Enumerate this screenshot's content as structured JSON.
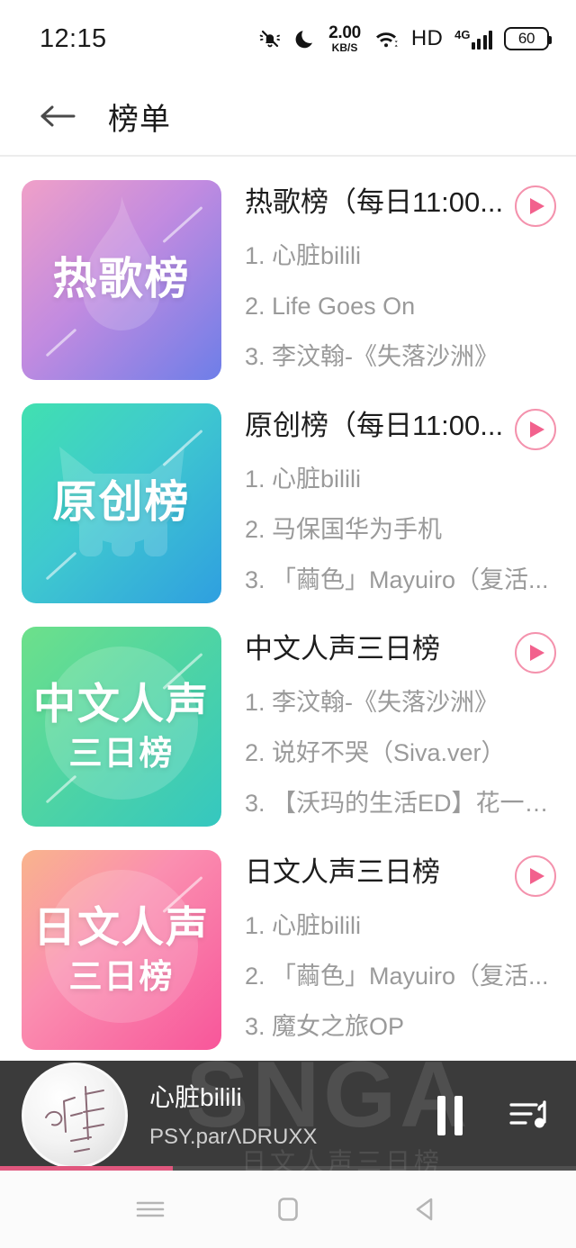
{
  "statusbar": {
    "time": "12:15",
    "network_speed": {
      "value": "2.00",
      "unit": "KB/S"
    },
    "hd_label": "HD",
    "network_type": "4G",
    "battery_level": "60",
    "icons": [
      "bell-mute-icon",
      "moon-dnd-icon",
      "wifi-icon",
      "signal-bars-icon",
      "battery-icon"
    ]
  },
  "appbar": {
    "back_icon": "back-arrow-icon",
    "title": "榜单"
  },
  "rankings": [
    {
      "title": "热歌榜（每日11:00...",
      "thumb": {
        "line1": "热歌榜",
        "line2": "",
        "gradient_from": "#f0a0c8",
        "gradient_to": "#6e7ee8",
        "watermark": "flame-icon"
      },
      "songs": [
        "1. 心脏bilili",
        "2. Life Goes On",
        "3. 李汶翰-《失落沙洲》"
      ],
      "play_label": "play-icon"
    },
    {
      "title": "原创榜（每日11:00...",
      "thumb": {
        "line1": "原创榜",
        "line2": "",
        "gradient_from": "#41e0b0",
        "gradient_to": "#2f9fe0",
        "watermark": "cat-logo-icon"
      },
      "songs": [
        "1. 心脏bilili",
        "2. 马保国华为手机",
        "3. 「繭色」Mayuiro（复活..."
      ],
      "play_label": "play-icon"
    },
    {
      "title": "中文人声三日榜",
      "thumb": {
        "line1": "中文人声",
        "line2": "三日榜",
        "gradient_from": "#6de08a",
        "gradient_to": "#35c7c0",
        "watermark": "disc-icon"
      },
      "songs": [
        "1. 李汶翰-《失落沙洲》",
        "2. 说好不哭（Siva.ver）",
        "3. 【沃玛的生活ED】花一天..."
      ],
      "play_label": "play-icon"
    },
    {
      "title": "日文人声三日榜",
      "thumb": {
        "line1": "日文人声",
        "line2": "三日榜",
        "gradient_from": "#f9b48c",
        "gradient_to": "#f8569a",
        "watermark": "disc-icon"
      },
      "songs": [
        "1. 心脏bilili",
        "2. 「繭色」Mayuiro（复活...",
        "3. 魔女之旅OP"
      ],
      "play_label": "play-icon"
    }
  ],
  "player": {
    "song_title": "心脏bilili",
    "artist": "PSY.parΛDRUXX",
    "watermark_big": "SNGA",
    "watermark_sub": "日文人声三日榜",
    "pause_icon": "pause-icon",
    "queue_icon": "playlist-music-icon",
    "progress_percent": 30,
    "accent_color": "#e0577e"
  },
  "navbar": {
    "recents_icon": "recents-menu-icon",
    "home_icon": "home-square-icon",
    "back_icon": "back-triangle-icon"
  }
}
